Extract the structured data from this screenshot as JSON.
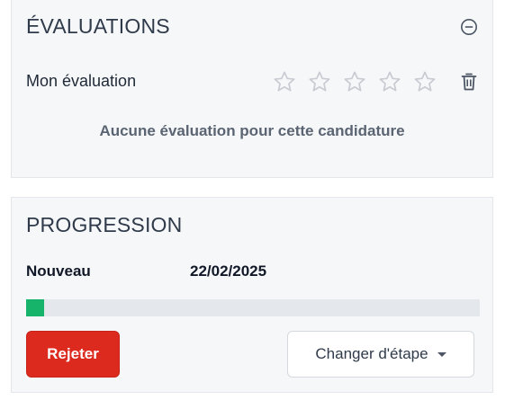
{
  "evaluations": {
    "title": "ÉVALUATIONS",
    "collapse_icon": "minus-circle-icon",
    "my_rating_label": "Mon évaluation",
    "stars_total": 5,
    "stars_filled": 0,
    "star_icon": "star-outline-icon",
    "delete_icon": "trash-icon",
    "empty_message": "Aucune évaluation pour cette candidature"
  },
  "progression": {
    "title": "PROGRESSION",
    "stage_name": "Nouveau",
    "stage_date": "22/02/2025",
    "progress_fraction": 0.04,
    "reject_label": "Rejeter",
    "change_stage_label": "Changer d'étape",
    "dropdown_icon": "caret-down-icon"
  },
  "colors": {
    "card_bg": "#f6f7f9",
    "progress_fill": "#16b36b",
    "progress_track": "#e4e7eb",
    "reject_bg": "#dc2a1e",
    "star_outline": "#c8ccd2"
  }
}
